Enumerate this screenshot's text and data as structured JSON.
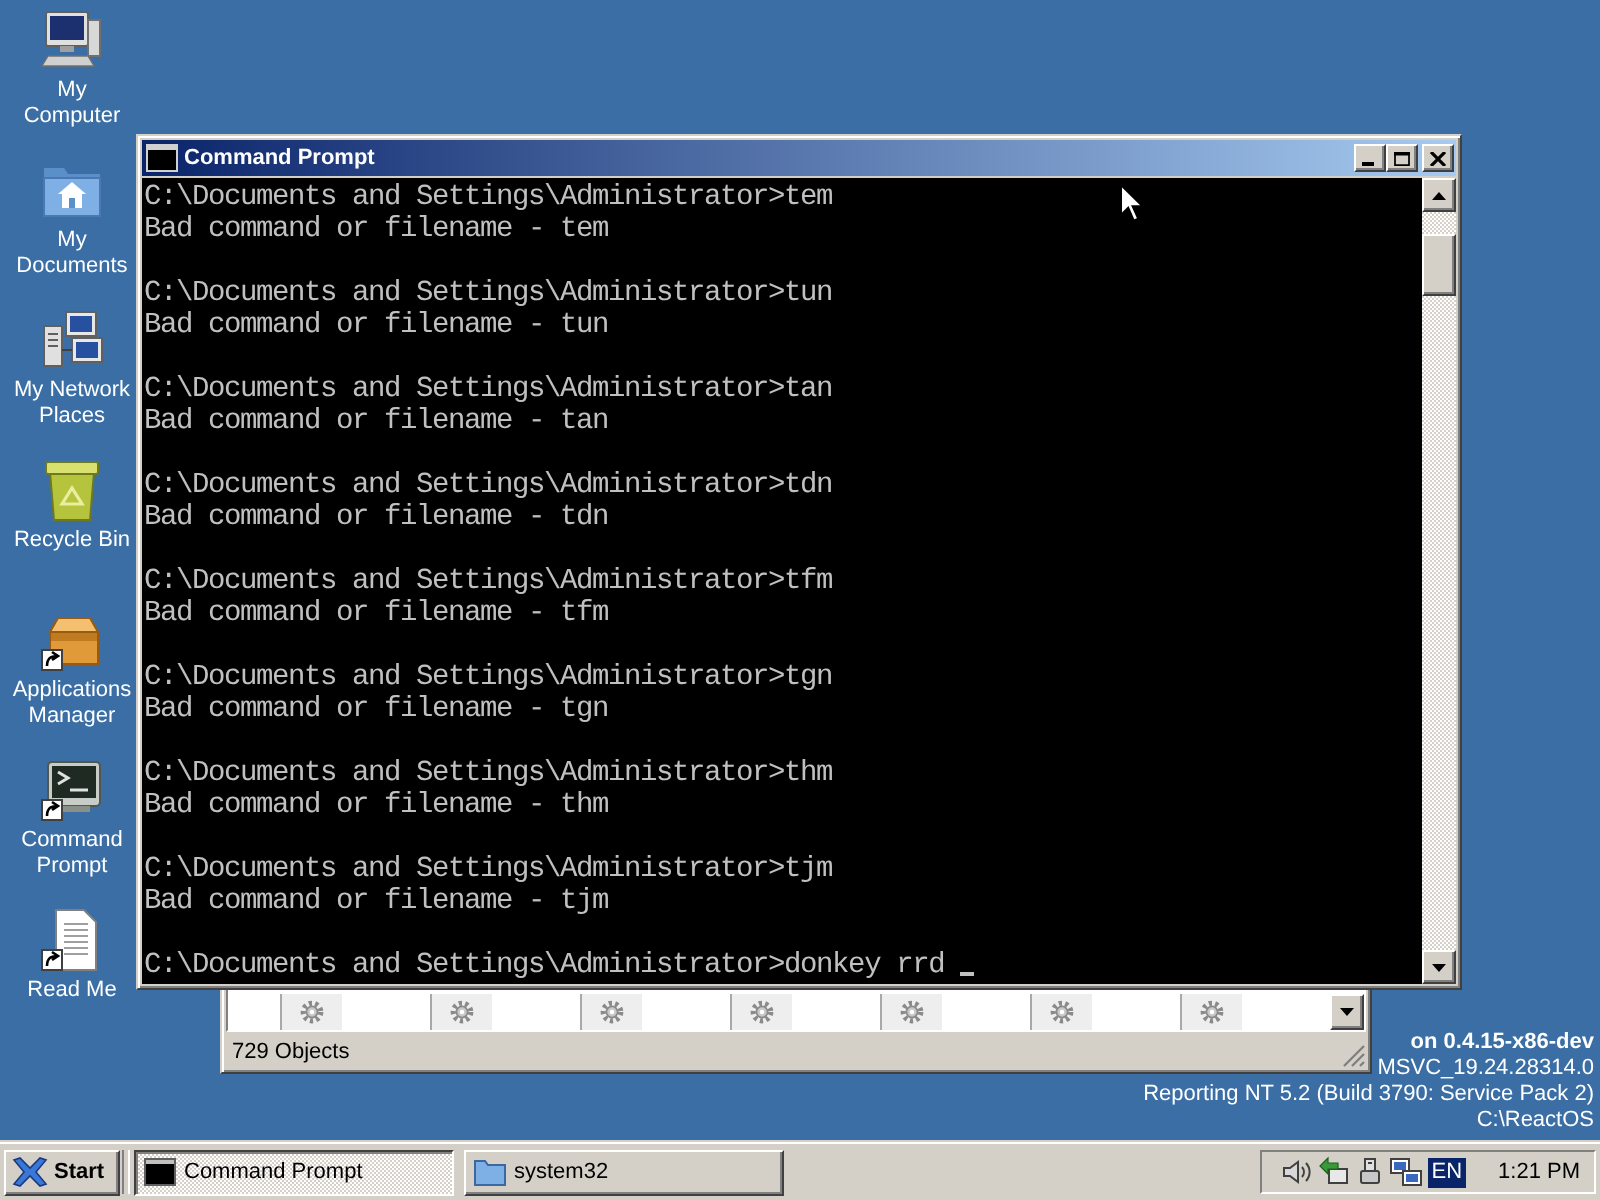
{
  "desktop_icons": [
    {
      "label": "My Computer",
      "kind": "computer",
      "shortcut": false
    },
    {
      "label": "My Documents",
      "kind": "documents",
      "shortcut": false
    },
    {
      "label": "My Network Places",
      "kind": "network",
      "shortcut": false
    },
    {
      "label": "Recycle Bin",
      "kind": "recycle",
      "shortcut": false
    },
    {
      "label": "Applications Manager",
      "kind": "package",
      "shortcut": true
    },
    {
      "label": "Command Prompt",
      "kind": "console",
      "shortcut": true
    },
    {
      "label": "Read Me",
      "kind": "document",
      "shortcut": true
    }
  ],
  "console_window": {
    "title": "Command Prompt",
    "blocks": [
      {
        "lines": [
          "C:\\Documents and Settings\\Administrator>tem",
          "Bad command or filename - tem"
        ]
      },
      {
        "lines": [
          "C:\\Documents and Settings\\Administrator>tun",
          "Bad command or filename - tun"
        ]
      },
      {
        "lines": [
          "C:\\Documents and Settings\\Administrator>tan",
          "Bad command or filename - tan"
        ]
      },
      {
        "lines": [
          "C:\\Documents and Settings\\Administrator>tdn",
          "Bad command or filename - tdn"
        ]
      },
      {
        "lines": [
          "C:\\Documents and Settings\\Administrator>tfm",
          "Bad command or filename - tfm"
        ]
      },
      {
        "lines": [
          "C:\\Documents and Settings\\Administrator>tgn",
          "Bad command or filename - tgn"
        ]
      },
      {
        "lines": [
          "C:\\Documents and Settings\\Administrator>thm",
          "Bad command or filename - thm"
        ]
      },
      {
        "lines": [
          "C:\\Documents and Settings\\Administrator>tjm",
          "Bad command or filename - tjm"
        ]
      }
    ],
    "input": {
      "text": "C:\\Documents and Settings\\Administrator>donkey rrd",
      "cursor": true
    }
  },
  "explorer_window": {
    "status": "729 Objects"
  },
  "version_info": [
    "on 0.4.15-x86-dev",
    "MSVC_19.24.28314.0",
    "Reporting NT 5.2 (Build 3790: Service Pack 2)",
    "C:\\ReactOS"
  ],
  "taskbar": {
    "start": "Start",
    "tasks": [
      {
        "label": "Command Prompt",
        "kind": "console",
        "selected": true
      },
      {
        "label": "system32",
        "kind": "folder",
        "selected": false
      }
    ],
    "language": "EN",
    "clock": "1:21 PM"
  }
}
